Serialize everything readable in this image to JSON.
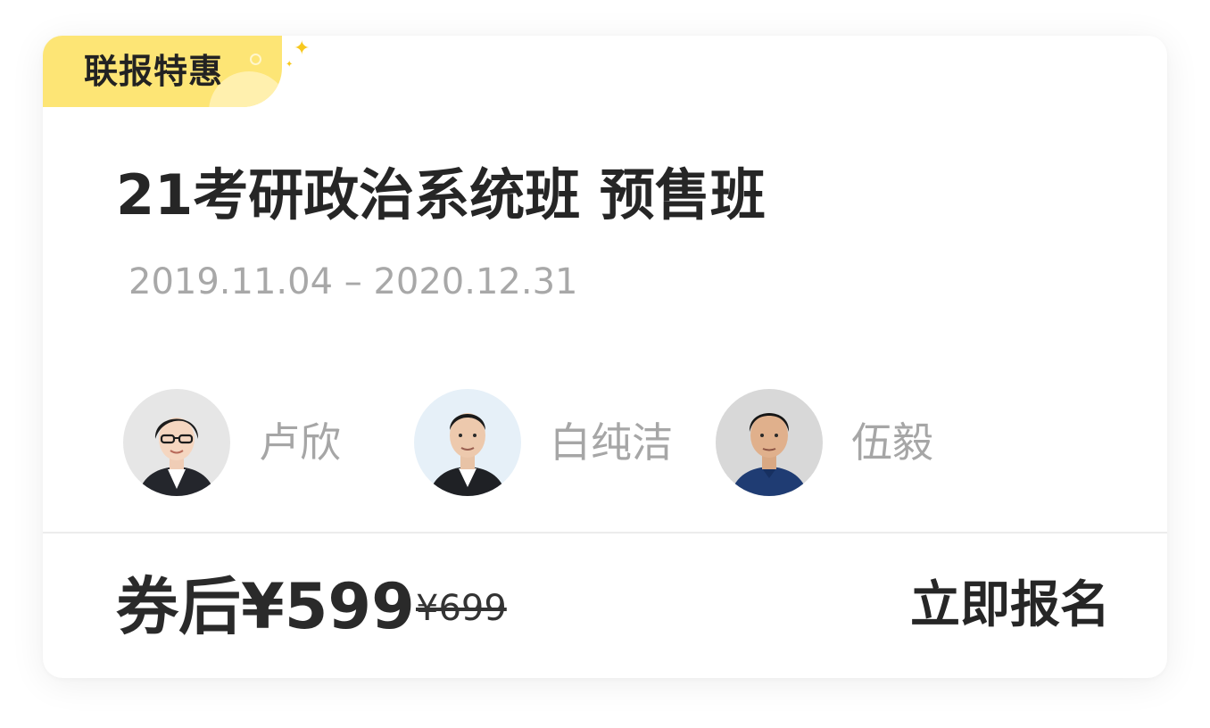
{
  "badge": {
    "label": "联报特惠"
  },
  "course": {
    "title": "21考研政治系统班 预售班",
    "date_range": "2019.11.04 – 2020.12.31"
  },
  "teachers": [
    {
      "name": "卢欣",
      "icon": "teacher-photo-icon"
    },
    {
      "name": "白纯洁",
      "icon": "teacher-photo-icon"
    },
    {
      "name": "伍毅",
      "icon": "teacher-photo-icon"
    }
  ],
  "pricing": {
    "discount_price": "券后¥599",
    "original_price": "¥699"
  },
  "action": {
    "enroll_label": "立即报名"
  },
  "colors": {
    "badge_bg": "#fde575",
    "sparkle": "#f7c81e",
    "title_text": "#262626",
    "muted_text": "#a8a8a8"
  }
}
